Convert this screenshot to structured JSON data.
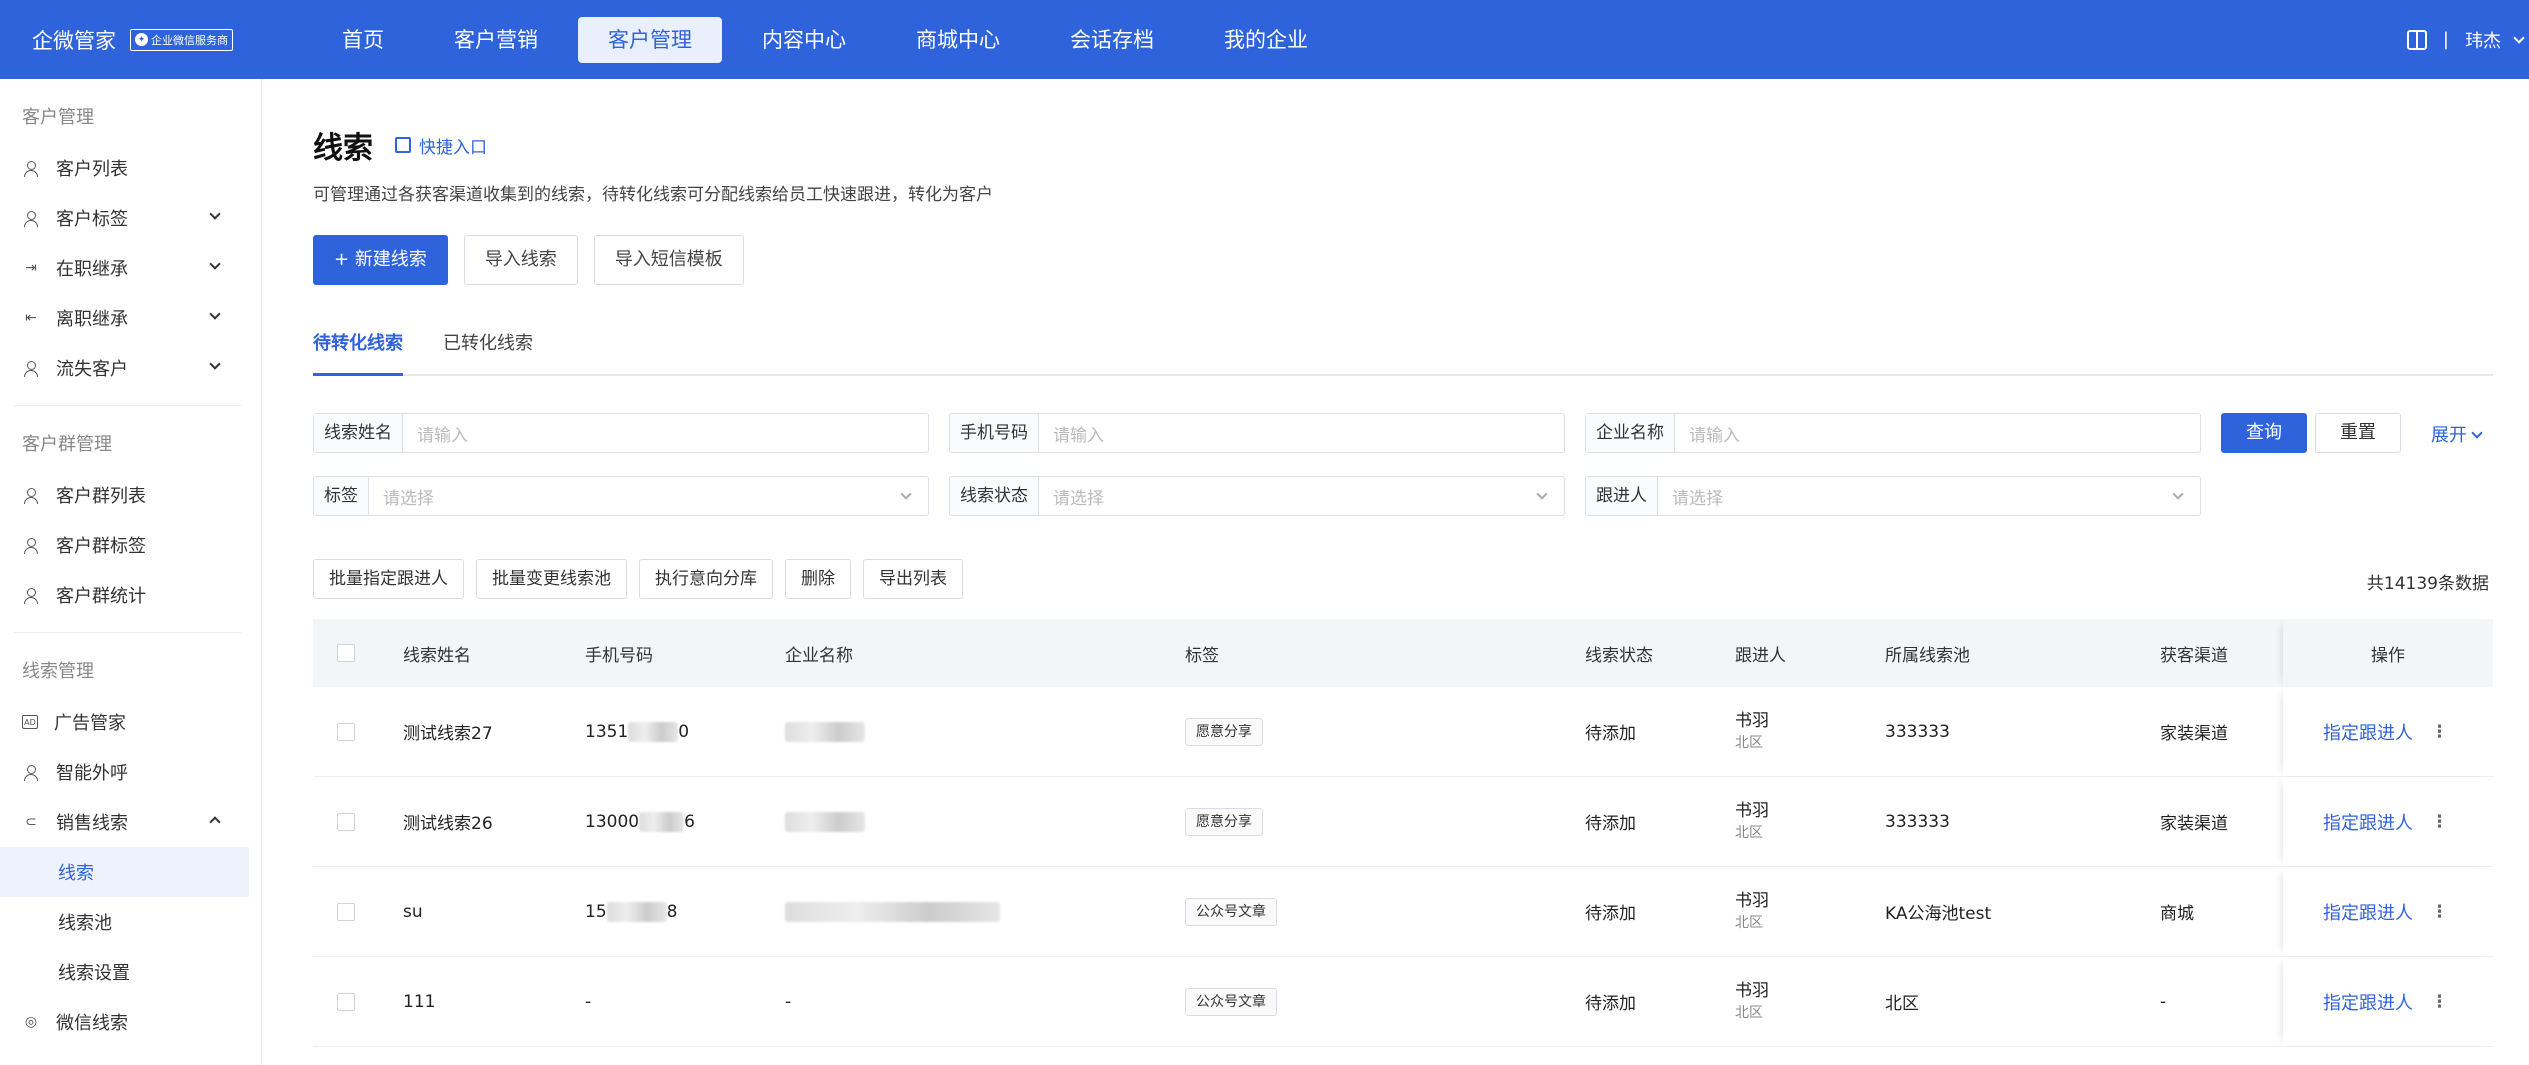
{
  "top_nav": {
    "brand": "企微管家",
    "badge": "企业微信服务商",
    "items": [
      {
        "label": "首页",
        "active": false
      },
      {
        "label": "客户营销",
        "active": false
      },
      {
        "label": "客户管理",
        "active": true
      },
      {
        "label": "内容中心",
        "active": false
      },
      {
        "label": "商城中心",
        "active": false
      },
      {
        "label": "会话存档",
        "active": false
      },
      {
        "label": "我的企业",
        "active": false
      }
    ],
    "separator": "|",
    "user": "玮杰"
  },
  "sidebar": {
    "groups": [
      {
        "title": "客户管理",
        "items": [
          {
            "label": "客户列表",
            "icon": "user-icon",
            "expandable": false
          },
          {
            "label": "客户标签",
            "icon": "user-tag-icon",
            "expandable": true
          },
          {
            "label": "在职继承",
            "icon": "login-icon",
            "expandable": true
          },
          {
            "label": "离职继承",
            "icon": "logout-icon",
            "expandable": true
          },
          {
            "label": "流失客户",
            "icon": "user-icon",
            "expandable": true
          }
        ]
      },
      {
        "title": "客户群管理",
        "items": [
          {
            "label": "客户群列表",
            "icon": "group-icon",
            "expandable": false
          },
          {
            "label": "客户群标签",
            "icon": "group-tag-icon",
            "expandable": false
          },
          {
            "label": "客户群统计",
            "icon": "group-stat-icon",
            "expandable": false
          }
        ]
      },
      {
        "title": "线索管理",
        "items": [
          {
            "label": "广告管家",
            "icon": "ad-icon",
            "expandable": false
          },
          {
            "label": "智能外呼",
            "icon": "call-icon",
            "expandable": false
          },
          {
            "label": "销售线索",
            "icon": "lead-icon",
            "expandable": true,
            "expanded": true
          }
        ]
      }
    ],
    "subitems": [
      {
        "label": "线索",
        "active": true
      },
      {
        "label": "线索池",
        "active": false
      },
      {
        "label": "线索设置",
        "active": false
      }
    ],
    "last_item": {
      "label": "微信线索",
      "icon": "wechat-lead-icon"
    }
  },
  "main": {
    "title": "线索",
    "quick_entry": "快捷入口",
    "description": "可管理通过各获客渠道收集到的线索，待转化线索可分配线索给员工快速跟进，转化为客户",
    "buttons": {
      "new": "新建线索",
      "import": "导入线索",
      "import_sms": "导入短信模板"
    },
    "tabs": [
      {
        "label": "待转化线索",
        "active": true
      },
      {
        "label": "已转化线索",
        "active": false
      }
    ],
    "filters": {
      "name": {
        "label": "线索姓名",
        "placeholder": "请输入"
      },
      "phone": {
        "label": "手机号码",
        "placeholder": "请输入"
      },
      "company": {
        "label": "企业名称",
        "placeholder": "请输入"
      },
      "tag": {
        "label": "标签",
        "placeholder": "请选择"
      },
      "status": {
        "label": "线索状态",
        "placeholder": "请选择"
      },
      "owner": {
        "label": "跟进人",
        "placeholder": "请选择"
      },
      "query": "查询",
      "reset": "重置",
      "expand": "展开"
    },
    "batch_actions": [
      "批量指定跟进人",
      "批量变更线索池",
      "执行意向分库",
      "删除",
      "导出列表"
    ],
    "total": "共14139条数据",
    "table": {
      "headers": [
        "线索姓名",
        "手机号码",
        "企业名称",
        "标签",
        "线索状态",
        "跟进人",
        "所属线索池",
        "获客渠道",
        "操作"
      ],
      "rows": [
        {
          "name": "测试线索27",
          "phone_start": "1351",
          "phone_end": "0",
          "company": "",
          "tag": "愿意分享",
          "status": "待添加",
          "owner": "书羽",
          "owner_sub": "北区",
          "pool": "333333",
          "channel": "家装渠道",
          "op": "指定跟进人"
        },
        {
          "name": "测试线索26",
          "phone_start": "13000",
          "phone_end": "6",
          "company": "",
          "tag": "愿意分享",
          "status": "待添加",
          "owner": "书羽",
          "owner_sub": "北区",
          "pool": "333333",
          "channel": "家装渠道",
          "op": "指定跟进人"
        },
        {
          "name": "su",
          "phone_start": "15",
          "phone_end": "8",
          "company": "",
          "tag": "公众号文章",
          "status": "待添加",
          "owner": "书羽",
          "owner_sub": "北区",
          "pool": "KA公海池test",
          "channel": "商城",
          "op": "指定跟进人"
        },
        {
          "name": "111",
          "phone_start": "-",
          "phone_end": "",
          "company": "-",
          "tag": "公众号文章",
          "status": "待添加",
          "owner": "书羽",
          "owner_sub": "北区",
          "pool": "北区",
          "channel": "-",
          "op": "指定跟进人"
        }
      ]
    }
  },
  "colors": {
    "primary": "#2f63db",
    "nav_active_bg": "#e9effc",
    "sidebar_active_bg": "#edf2fd"
  }
}
